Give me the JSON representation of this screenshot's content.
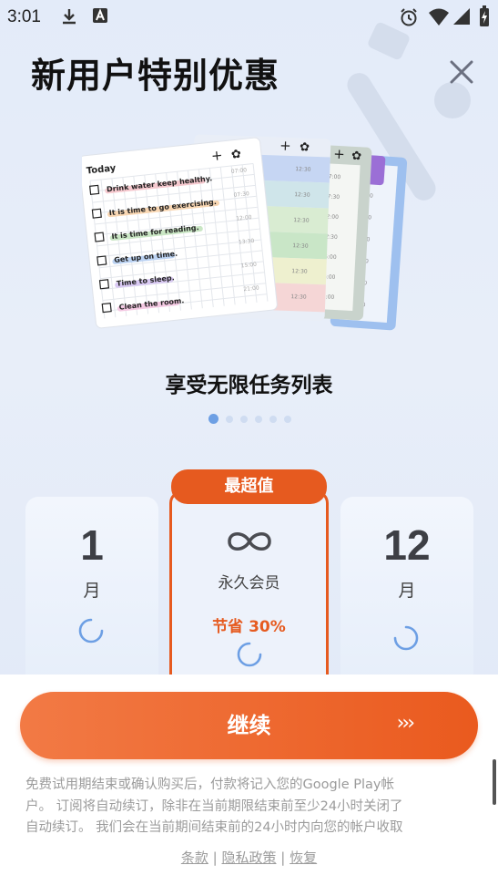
{
  "status_bar": {
    "time": "3:01"
  },
  "title": "新用户特别优惠",
  "promo": {
    "caption": "享受无限任务列表",
    "card": {
      "header": "Today",
      "tasks": [
        {
          "text": "Drink water keep healthy.",
          "time": "07:00"
        },
        {
          "text": "It is time to go exercising.",
          "time": "07:30"
        },
        {
          "text": "It is time for reading.",
          "time": "12:00"
        },
        {
          "text": "Get up on time.",
          "time": "13:30"
        },
        {
          "text": "Time to sleep.",
          "time": "15:00"
        },
        {
          "text": "Clean the room.",
          "time": "21:00"
        }
      ],
      "back_times": [
        "12:30",
        "12:30",
        "12:30",
        "12:30",
        "12:30",
        "12:30"
      ],
      "back2_times": [
        "07:00",
        "07:30",
        "12:00",
        "12:30",
        "15:00",
        "16:00",
        "18:00"
      ],
      "back3_times": [
        "07:00",
        "07:30",
        "12:00",
        "13:30",
        "15:00",
        "21:00"
      ]
    },
    "dots_total": 6,
    "dots_active": 0
  },
  "plans": {
    "left": {
      "number": "1",
      "unit": "月"
    },
    "middle": {
      "badge": "最超值",
      "label": "永久会员",
      "save": "节省 30%"
    },
    "right": {
      "number": "12",
      "unit": "月"
    }
  },
  "continue": {
    "label": "继续",
    "arrows": "›››"
  },
  "disclaimer": {
    "line1": "免费试用期结束或确认购买后，付款将记入您的Google Play帐",
    "line2": "户。 订阅将自动续订，除非在当前期限结束前至少24小时关闭了",
    "line3": "自动续订。 我们会在当前期间结束前的24小时内向您的帐户收取"
  },
  "links": {
    "terms": "条款",
    "privacy": "隐私政策",
    "restore": "恢复",
    "separator": "|"
  },
  "colors": {
    "accent": "#e65a1f",
    "spinner": "#6d9fe4",
    "dot_active": "#6d9fe4"
  }
}
